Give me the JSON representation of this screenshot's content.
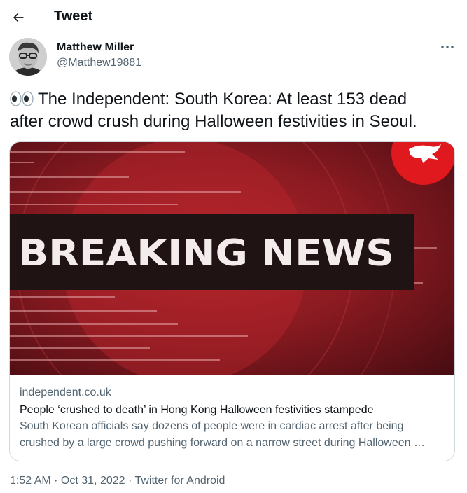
{
  "header": {
    "back_icon": "arrow-left-icon",
    "title": "Tweet"
  },
  "author": {
    "name": "Matthew Miller",
    "handle": "@Matthew19881",
    "more_icon": "more-horizontal-icon"
  },
  "tweet": {
    "emoji": "eyes-emoji",
    "text_line1": "The Independent: South Korea: At least 153 dead",
    "text_line2": "after crowd crush during Halloween festivities in Seoul."
  },
  "card": {
    "image_text": "BREAKING NEWS",
    "domain": "independent.co.uk",
    "title": "People ‘crushed to death’ in Hong Kong Halloween festivities stampede",
    "description_line1": "South Korean officials say dozens of people were in cardiac arrest after being",
    "description_line2": "crushed by a large crowd pushing forward on a narrow street during Halloween …"
  },
  "meta": {
    "time": "1:52 AM",
    "date": "Oct 31, 2022",
    "separator": " · ",
    "source": "Twitter for Android"
  },
  "colors": {
    "text_primary": "#0f1419",
    "text_secondary": "#536471",
    "border": "#cfd9de",
    "breaking_red": "#8b1a20",
    "logo_red": "#e0191f"
  }
}
